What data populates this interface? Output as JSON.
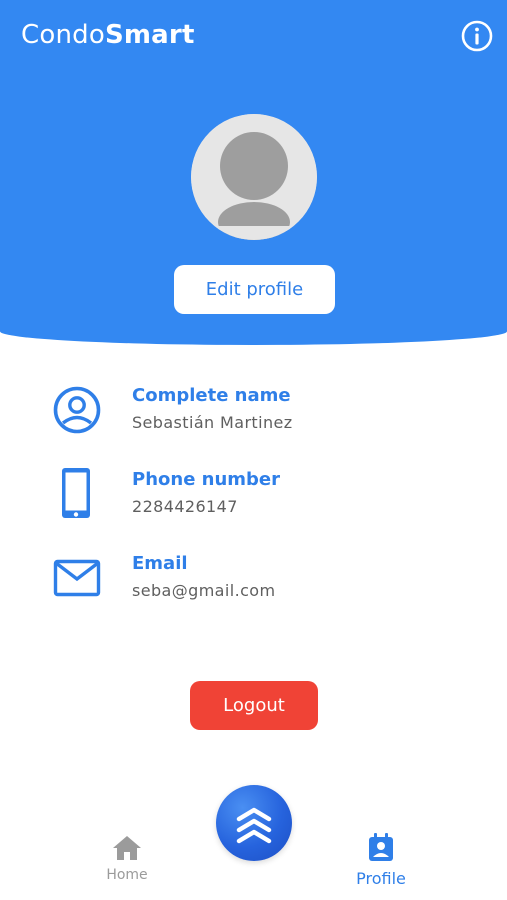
{
  "header": {
    "brand_light": "Condo",
    "brand_bold": "Smart",
    "edit_label": "Edit profile"
  },
  "profile": {
    "fields": [
      {
        "label": "Complete name",
        "value": "Sebastián Martinez",
        "icon": "account-circle-icon"
      },
      {
        "label": "Phone number",
        "value": "2284426147",
        "icon": "smartphone-icon"
      },
      {
        "label": "Email",
        "value": "seba@gmail.com",
        "icon": "mail-icon"
      }
    ]
  },
  "actions": {
    "logout_label": "Logout"
  },
  "nav": {
    "items": [
      {
        "label": "Home",
        "icon": "home-icon"
      },
      {
        "label": "Profile",
        "icon": "contact-page-icon"
      }
    ],
    "center_icon": "chevrons-up-icon"
  },
  "colors": {
    "primary": "#3388f2",
    "accent_text": "#2f7fe8",
    "logout": "#f04336",
    "muted": "#9b9b9b"
  }
}
